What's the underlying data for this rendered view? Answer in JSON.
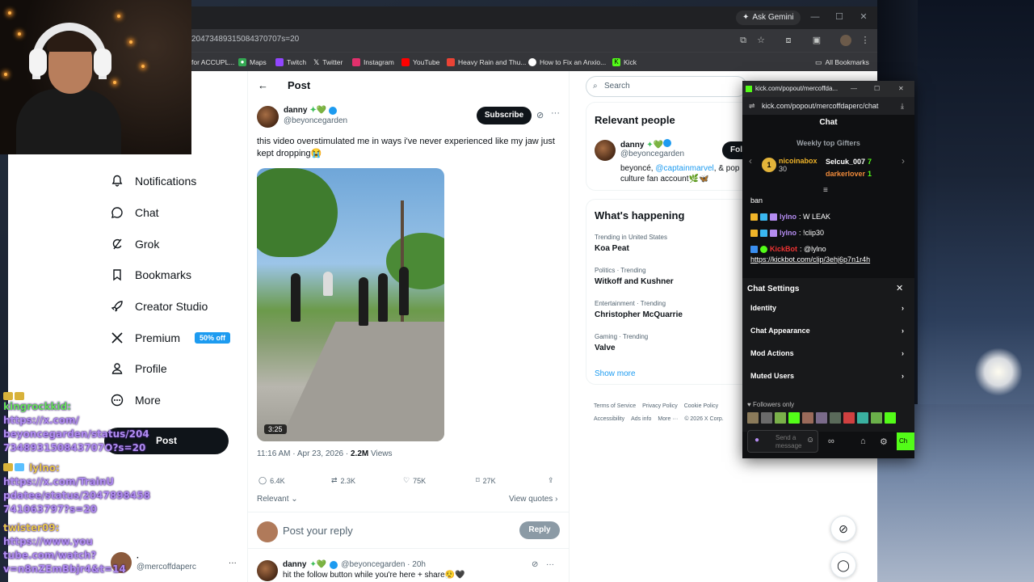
{
  "browser": {
    "ask_gemini": "Ask Gemini",
    "url": "20473489315084370707s=20",
    "bookmarks": [
      "for ACCUPL...",
      "Maps",
      "Twitch",
      "Twitter",
      "Instagram",
      "YouTube",
      "Heavy Rain and Thu...",
      "How to Fix an Anxio...",
      "Kick"
    ],
    "all_bookmarks": "All Bookmarks"
  },
  "nav": {
    "items": [
      "Notifications",
      "Chat",
      "Grok",
      "Bookmarks",
      "Creator Studio",
      "Premium",
      "Profile",
      "More"
    ],
    "premium_badge": "50% off",
    "post_button": "Post",
    "account_name": "·",
    "account_handle": "@mercoffdaperc"
  },
  "stream_chat": {
    "line1_user": "kingrockkid:",
    "line1_text": "https://x.com/ beyoncegarden/status/204 734893150843707O?s=20",
    "line2_user": "lylno:",
    "line2_text": "https://x.com/TrainU pdatee/status/2047898458 741063797?s=20",
    "line3_user": "twister09:",
    "line3_text": "https://www.you tube.com/watch? v=n8nZEmBbjr4&t=14"
  },
  "post": {
    "header": "Post",
    "author_name": "danny",
    "author_handle": "@beyoncegarden",
    "subscribe": "Subscribe",
    "text": "this video overstimulated me in ways i've never experienced like my jaw just kept dropping😭",
    "duration": "3:25",
    "timestamp": "11:16 AM · Apr 23, 2026 · ",
    "views_count": "2.2M",
    "views_label": " Views",
    "replies": "6.4K",
    "reposts": "2.3K",
    "likes": "75K",
    "bookmarks": "27K",
    "relevant": "Relevant",
    "view_quotes": "View quotes",
    "reply_placeholder": "Post your reply",
    "reply_button": "Reply",
    "reply_author": "danny",
    "reply_handle": "@beyoncegarden · 20h",
    "reply_text": "hit the follow button while you're here + share😮‍💨🖤"
  },
  "right": {
    "search_placeholder": "Search",
    "relevant_people": "Relevant people",
    "person_name": "danny",
    "person_handle": "@beyoncegarden",
    "person_bio_a": "beyoncé, ",
    "person_bio_link": "@captainmarvel",
    "person_bio_b": ", & pop culture fan account🌿🦋",
    "follow": "Fol",
    "whats_happening": "What's happening",
    "trends": [
      {
        "cat": "Trending in United States",
        "name": "Koa Peat"
      },
      {
        "cat": "Politics · Trending",
        "name": "Witkoff and Kushner"
      },
      {
        "cat": "Entertainment · Trending",
        "name": "Christopher McQuarrie"
      },
      {
        "cat": "Gaming · Trending",
        "name": "Valve"
      }
    ],
    "show_more": "Show more",
    "footer": [
      "Terms of Service",
      "Privacy Policy",
      "Cookie Policy",
      "Accessibility",
      "Ads info",
      "More ···",
      "© 2026 X Corp."
    ]
  },
  "kick": {
    "title": "kick.com/popout/mercoffda...",
    "url": "kick.com/popout/mercoffdaperc/chat",
    "chat_header": "Chat",
    "gifters_header": "Weekly top Gifters",
    "gifter1_name": "nicoinabox",
    "gifter1_count": "30",
    "gifter2_name": "Selcuk_007",
    "gifter2_count": "7",
    "gifter3_name": "darkerlover",
    "gifter3_count": "1",
    "messages": [
      {
        "user": "",
        "text": "ban"
      },
      {
        "user": "lylno",
        "text": ": W LEAK"
      },
      {
        "user": "lylno",
        "text": ": !clip30"
      },
      {
        "user": "KickBot",
        "text": ": @lylno"
      }
    ],
    "clip_link": "https://kickbot.com/clip/3ehj6p7n1r4h",
    "settings_title": "Chat Settings",
    "settings": [
      "Identity",
      "Chat Appearance",
      "Mod Actions",
      "Muted Users"
    ],
    "followers_only": "Followers only",
    "input_placeholder": "Send a message",
    "send_label": "Ch"
  }
}
